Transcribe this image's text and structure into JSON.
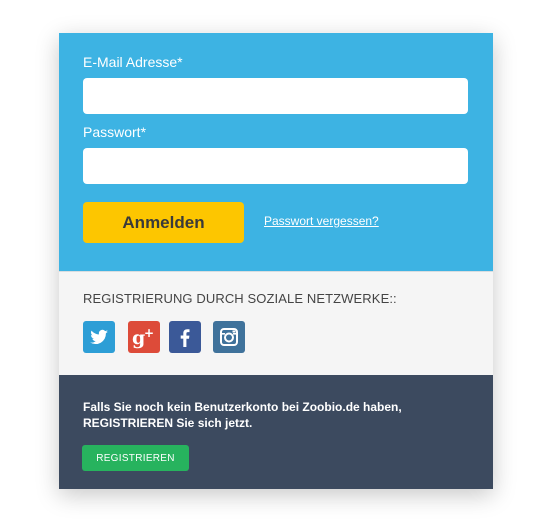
{
  "login": {
    "email_label": "E-Mail Adresse*",
    "email_value": "",
    "password_label": "Passwort*",
    "password_value": "",
    "submit_label": "Anmelden",
    "forgot_label": "Passwort vergessen?"
  },
  "social": {
    "title": "REGISTRIERUNG DURCH SOZIALE NETZWERKE::",
    "networks": [
      {
        "icon": "twitter-icon",
        "color": "#2d9ed6"
      },
      {
        "icon": "google-plus-icon",
        "color": "#dd4b39"
      },
      {
        "icon": "facebook-icon",
        "color": "#3b5998"
      },
      {
        "icon": "instagram-icon",
        "color": "#3f729b"
      }
    ]
  },
  "register": {
    "line1": "Falls Sie noch kein Benutzerkonto bei Zoobio.de haben,",
    "line2": "REGISTRIEREN Sie sich jetzt.",
    "button_label": "REGISTRIEREN"
  },
  "colors": {
    "login_bg": "#3db3e3",
    "login_button": "#fdc600",
    "register_bg": "#3c4a5f",
    "register_button": "#27b35e"
  }
}
